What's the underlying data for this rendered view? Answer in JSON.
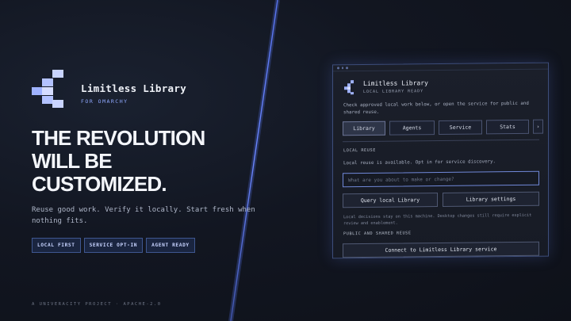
{
  "brand": {
    "title": "Limitless Library",
    "subtitle": "FOR OMARCHY"
  },
  "hero": {
    "headline_line1": "THE REVOLUTION",
    "headline_line2": "WILL BE",
    "headline_line3": "CUSTOMIZED.",
    "tagline": "Reuse good work. Verify it locally. Start fresh when nothing fits."
  },
  "badges": [
    "LOCAL FIRST",
    "SERVICE OPT-IN",
    "AGENT READY"
  ],
  "footer": "A UNIVERACITY PROJECT · APACHE-2.0",
  "panel": {
    "title": "Limitless Library",
    "status": "LOCAL LIBRARY READY",
    "description": "Check approved local work below, or open the service for public and shared reuse.",
    "tabs": [
      {
        "label": "Library",
        "active": true
      },
      {
        "label": "Agents",
        "active": false
      },
      {
        "label": "Service",
        "active": false
      },
      {
        "label": "Stats",
        "active": false
      }
    ],
    "more_tabs_glyph": "›",
    "local_section_label": "LOCAL REUSE",
    "local_status": "Local reuse is available. Opt in for service discovery.",
    "search_placeholder": "What are you about to make or change?",
    "query_button": "Query local Library",
    "settings_button": "Library settings",
    "note": "Local decisions stay on this machine. Desktop changes still require explicit review and enablement.",
    "public_section_label": "PUBLIC AND SHARED REUSE",
    "connect_button": "Connect to Limitless Library service"
  },
  "colors": {
    "accent": "#7088d8",
    "logo": "#b8c6ff",
    "glow_line": "#5d7bff"
  }
}
